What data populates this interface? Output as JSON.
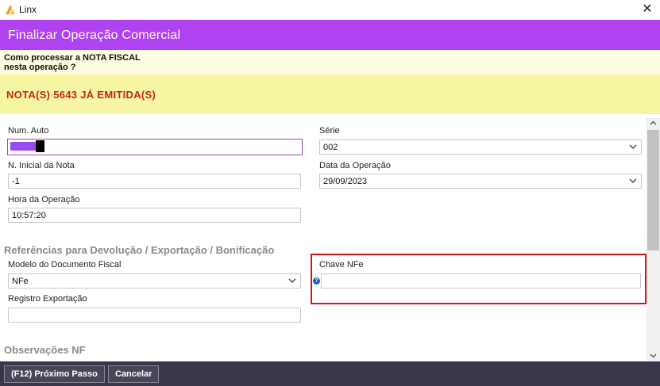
{
  "window": {
    "title": "Linx",
    "close_glyph": "✕"
  },
  "header": {
    "title": "Finalizar Operação Comercial"
  },
  "question": {
    "text": "Como processar a NOTA FISCAL\nnesta operação ?"
  },
  "alert": {
    "text": "NOTA(S) 5643 JÁ EMITIDA(S)",
    "color": "#c0291a"
  },
  "form": {
    "num_auto": {
      "label": "Num. Auto",
      "value": ""
    },
    "serie": {
      "label": "Série",
      "value": "002"
    },
    "n_inicial": {
      "label": "N. Inicial da Nota",
      "value": "-1"
    },
    "data_operacao": {
      "label": "Data da Operação",
      "value": "29/09/2023"
    },
    "hora_operacao": {
      "label": "Hora da Operação",
      "value": "10:57:20"
    }
  },
  "referencias": {
    "title": "Referências para Devolução / Exportação / Bonificação",
    "modelo": {
      "label": "Modelo do Documento Fiscal",
      "value": "NFe"
    },
    "registro": {
      "label": "Registro Exportação",
      "value": ""
    },
    "chave": {
      "label": "Chave NFe",
      "value": "",
      "help_glyph": "?"
    }
  },
  "observacoes": {
    "title": "Observações NF"
  },
  "footer": {
    "next_button": "(F12) Próximo Passo",
    "cancel_button": "Cancelar"
  },
  "colors": {
    "header_bg": "#b142f2",
    "highlight_border": "#d0141c",
    "footer_bg": "#3b3549"
  }
}
